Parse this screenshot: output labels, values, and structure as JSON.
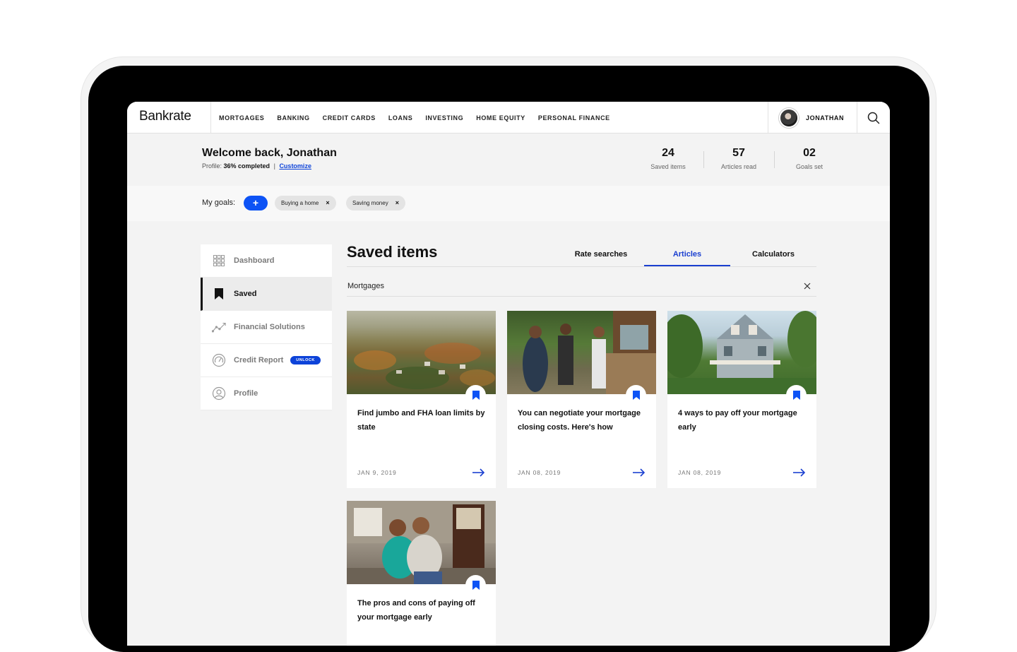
{
  "brand": {
    "name": "Bankrate"
  },
  "nav": {
    "items": [
      "MORTGAGES",
      "BANKING",
      "CREDIT CARDS",
      "LOANS",
      "INVESTING",
      "HOME EQUITY",
      "PERSONAL FINANCE"
    ],
    "user_name": "JONATHAN"
  },
  "welcome": {
    "heading": "Welcome back, Jonathan",
    "profile_prefix": "Profile:",
    "profile_value": "36% completed",
    "separator": "|",
    "customize": "Customize"
  },
  "stats": [
    {
      "value": "24",
      "label": "Saved items"
    },
    {
      "value": "57",
      "label": "Articles read"
    },
    {
      "value": "02",
      "label": "Goals set"
    }
  ],
  "goals": {
    "label": "My goals:",
    "add": "+",
    "chips": [
      "Buying a home",
      "Saving money"
    ],
    "chip_remove": "×"
  },
  "sidebar": {
    "items": [
      {
        "label": "Dashboard",
        "icon": "grid-icon"
      },
      {
        "label": "Saved",
        "icon": "bookmark-icon"
      },
      {
        "label": "Financial Solutions",
        "icon": "trend-icon"
      },
      {
        "label": "Credit Report",
        "icon": "gauge-icon",
        "badge": "UNLOCK"
      },
      {
        "label": "Profile",
        "icon": "user-icon"
      }
    ]
  },
  "main": {
    "title": "Saved items",
    "tabs": [
      "Rate searches",
      "Articles",
      "Calculators"
    ],
    "active_tab": "Articles",
    "filter": "Mortgages"
  },
  "cards": [
    {
      "title": "Find jumbo and FHA loan limits by state",
      "date": "JAN 9, 2019"
    },
    {
      "title": "You can negotiate your mortgage closing costs. Here's how",
      "date": "JAN 08, 2019"
    },
    {
      "title": "4 ways to pay off your mortgage early",
      "date": "JAN 08, 2019"
    },
    {
      "title": "The pros and cons of paying off your mortgage early",
      "date": ""
    }
  ],
  "colors": {
    "accent": "#0d53f5",
    "tab_active": "#1a3fd0",
    "text": "#111111"
  }
}
